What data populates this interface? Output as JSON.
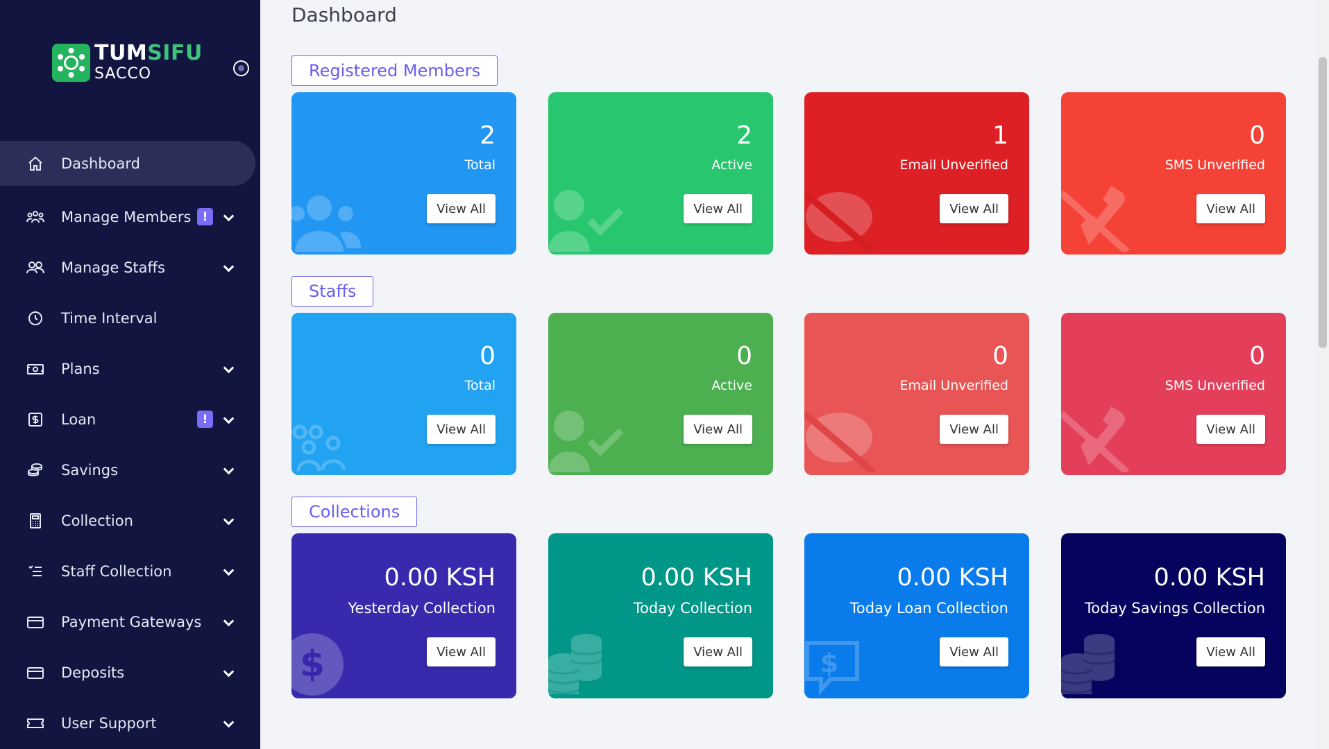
{
  "brand": {
    "name_part1": "TUM",
    "name_part2": "SIFU",
    "sub": "SACCO"
  },
  "sidebar": {
    "items": [
      {
        "label": "Dashboard",
        "icon": "home-icon",
        "badge": null,
        "chevron": false,
        "active": true
      },
      {
        "label": "Manage Members",
        "icon": "members-icon",
        "badge": "!",
        "chevron": true,
        "active": false
      },
      {
        "label": "Manage Staffs",
        "icon": "staffs-icon",
        "badge": null,
        "chevron": true,
        "active": false
      },
      {
        "label": "Time Interval",
        "icon": "clock-icon",
        "badge": null,
        "chevron": false,
        "active": false
      },
      {
        "label": "Plans",
        "icon": "money-icon",
        "badge": null,
        "chevron": true,
        "active": false
      },
      {
        "label": "Loan",
        "icon": "dollar-icon",
        "badge": "!",
        "chevron": true,
        "active": false
      },
      {
        "label": "Savings",
        "icon": "coins-icon",
        "badge": null,
        "chevron": true,
        "active": false
      },
      {
        "label": "Collection",
        "icon": "calculator-icon",
        "badge": null,
        "chevron": true,
        "active": false
      },
      {
        "label": "Staff Collection",
        "icon": "list-icon",
        "badge": null,
        "chevron": true,
        "active": false
      },
      {
        "label": "Payment Gateways",
        "icon": "card-icon",
        "badge": null,
        "chevron": true,
        "active": false
      },
      {
        "label": "Deposits",
        "icon": "card-icon",
        "badge": null,
        "chevron": true,
        "active": false
      },
      {
        "label": "User Support",
        "icon": "ticket-icon",
        "badge": null,
        "chevron": true,
        "active": false
      }
    ]
  },
  "page": {
    "title": "Dashboard"
  },
  "sections": [
    {
      "label": "Registered Members",
      "cards": [
        {
          "value": "2",
          "label": "Total",
          "button": "View All",
          "color": "#2196f3",
          "icon": "users-icon"
        },
        {
          "value": "2",
          "label": "Active",
          "button": "View All",
          "color": "#28c76f",
          "icon": "user-check-icon"
        },
        {
          "value": "1",
          "label": "Email Unverified",
          "button": "View All",
          "color": "#dc2025",
          "icon": "comment-slash-icon"
        },
        {
          "value": "0",
          "label": "SMS Unverified",
          "button": "View All",
          "color": "#f44336",
          "icon": "phone-slash-icon"
        }
      ]
    },
    {
      "label": "Staffs",
      "cards": [
        {
          "value": "0",
          "label": "Total",
          "button": "View All",
          "color": "#22a3f2",
          "icon": "users-group-icon"
        },
        {
          "value": "0",
          "label": "Active",
          "button": "View All",
          "color": "#4caf50",
          "icon": "user-check-icon"
        },
        {
          "value": "0",
          "label": "Email Unverified",
          "button": "View All",
          "color": "#e95454",
          "icon": "comment-slash-icon"
        },
        {
          "value": "0",
          "label": "SMS Unverified",
          "button": "View All",
          "color": "#e33e5a",
          "icon": "phone-slash-icon"
        }
      ]
    },
    {
      "label": "Collections",
      "cards": [
        {
          "value": "0.00 KSH",
          "label": "Yesterday Collection",
          "button": "View All",
          "color": "#372aac",
          "icon": "dollar-circle-icon"
        },
        {
          "value": "0.00 KSH",
          "label": "Today Collection",
          "button": "View All",
          "color": "#009688",
          "icon": "coins-icon"
        },
        {
          "value": "0.00 KSH",
          "label": "Today Loan Collection",
          "button": "View All",
          "color": "#097bea",
          "icon": "dollar-comment-icon"
        },
        {
          "value": "0.00 KSH",
          "label": "Today Savings Collection",
          "button": "View All",
          "color": "#04045e",
          "icon": "coins-icon"
        }
      ]
    }
  ]
}
